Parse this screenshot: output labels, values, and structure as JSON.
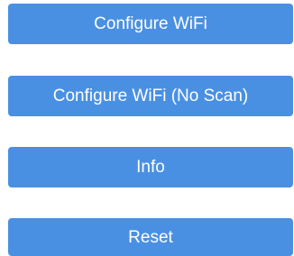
{
  "menu": {
    "buttons": [
      {
        "label": "Configure WiFi"
      },
      {
        "label": "Configure WiFi (No Scan)"
      },
      {
        "label": "Info"
      },
      {
        "label": "Reset"
      }
    ]
  },
  "colors": {
    "button_background": "#4a90e2",
    "button_text": "#ffffff",
    "page_background": "#ffffff"
  }
}
